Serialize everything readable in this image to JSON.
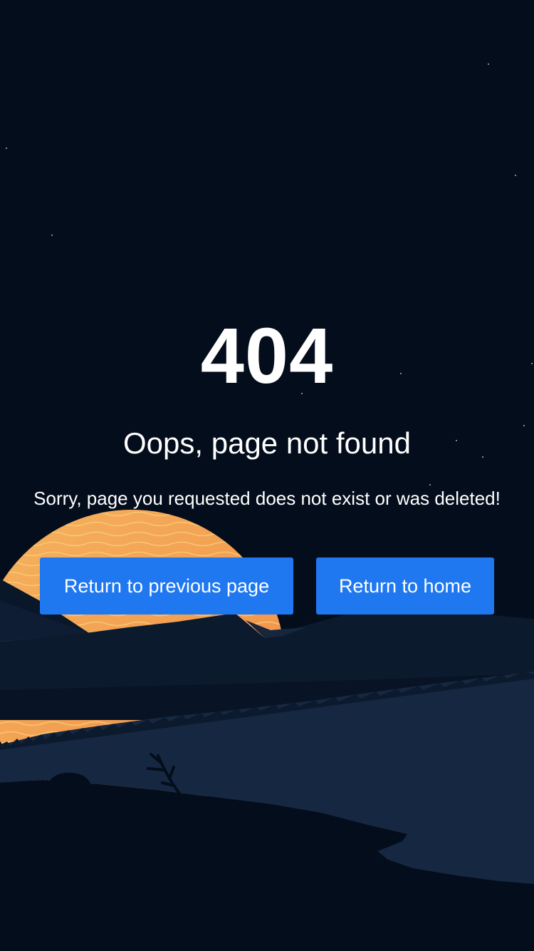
{
  "error": {
    "code": "404",
    "title": "Oops, page not found",
    "message": "Sorry, page you requested does not exist or was deleted!"
  },
  "actions": {
    "back_label": "Return to previous page",
    "home_label": "Return to home"
  },
  "colors": {
    "background": "#040d1b",
    "accent": "#1f78f0",
    "sun": "#f0a050",
    "hills": "#0c1a2e",
    "field": "#162841"
  }
}
